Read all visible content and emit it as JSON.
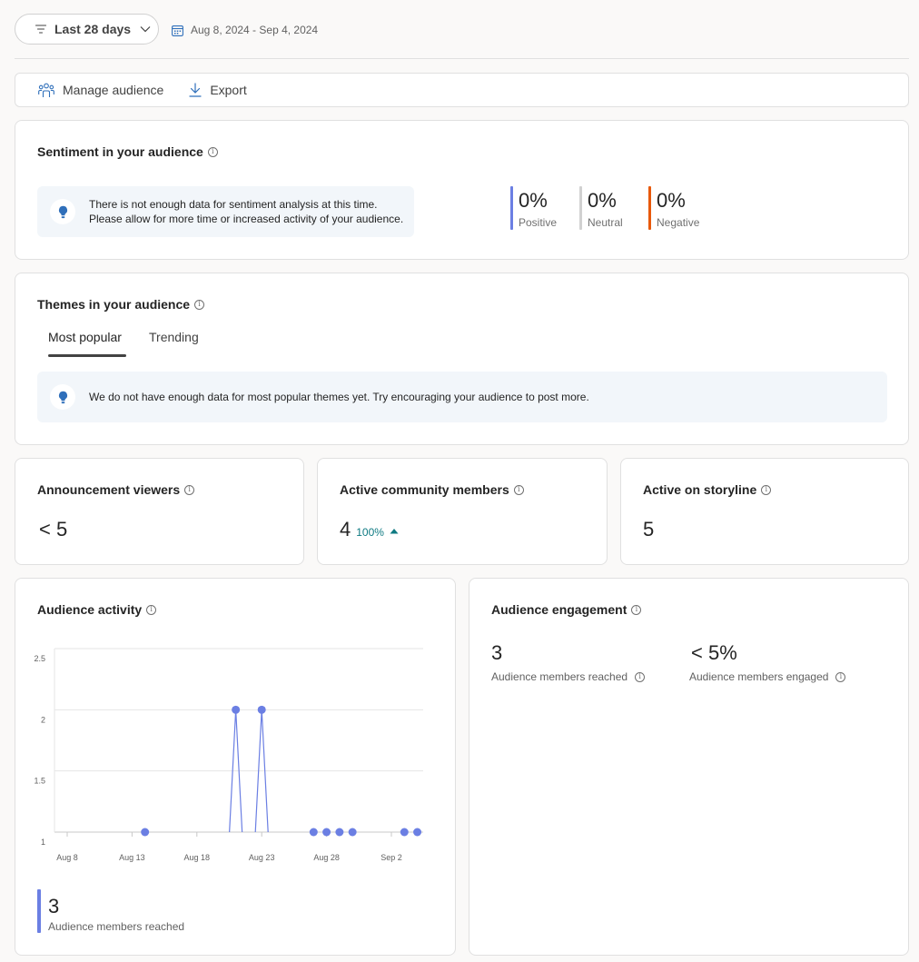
{
  "filter": {
    "range_label": "Last 28 days",
    "date_range": "Aug 8, 2024 - Sep 4, 2024"
  },
  "toolbar": {
    "manage_label": "Manage audience",
    "export_label": "Export"
  },
  "sentiment": {
    "title": "Sentiment in your audience",
    "notice_line1": "There is not enough data for sentiment analysis at this time.",
    "notice_line2": "Please allow for more time or increased activity of your audience.",
    "items": [
      {
        "value": "0%",
        "label": "Positive",
        "color": "#6b7fe3"
      },
      {
        "value": "0%",
        "label": "Neutral",
        "color": "#d1d1d1"
      },
      {
        "value": "0%",
        "label": "Negative",
        "color": "#e8590c"
      }
    ]
  },
  "themes": {
    "title": "Themes in your audience",
    "tabs": [
      "Most popular",
      "Trending"
    ],
    "selected_tab": "Most popular",
    "notice": "We do not have enough data for most popular themes yet. Try encouraging your audience to post more."
  },
  "stats": {
    "announcement": {
      "title": "Announcement viewers",
      "value": "< 5"
    },
    "community": {
      "title": "Active community members",
      "value": "4",
      "change": "100%",
      "trend": "up"
    },
    "storyline": {
      "title": "Active on storyline",
      "value": "5"
    }
  },
  "activity": {
    "title": "Audience activity",
    "summary_value": "3",
    "summary_label": "Audience members reached"
  },
  "engagement": {
    "title": "Audience engagement",
    "reached_value": "3",
    "reached_label": "Audience members reached",
    "engaged_value": "< 5%",
    "engaged_label": "Audience members engaged"
  },
  "chart_data": {
    "type": "line",
    "title": "Audience activity",
    "xlabel": "",
    "ylabel": "",
    "x_ticks": [
      "Aug 8",
      "Aug 13",
      "Aug 18",
      "Aug 23",
      "Aug 28",
      "Sep 2"
    ],
    "y_ticks": [
      "1",
      "1.5",
      "2",
      "2.5"
    ],
    "ylim": [
      1,
      2.5
    ],
    "grid": true,
    "series_color": "#6b7fe3",
    "series": [
      {
        "points": [
          {
            "x": "Aug 14",
            "y": 1
          },
          {
            "x": "Aug 21",
            "y": 2
          },
          {
            "x": "Aug 23",
            "y": 2
          },
          {
            "x": "Aug 27",
            "y": 1
          },
          {
            "x": "Aug 28",
            "y": 1
          },
          {
            "x": "Aug 29",
            "y": 1
          },
          {
            "x": "Aug 30",
            "y": 1
          },
          {
            "x": "Sep 3",
            "y": 1
          },
          {
            "x": "Sep 4",
            "y": 1
          }
        ]
      }
    ]
  }
}
